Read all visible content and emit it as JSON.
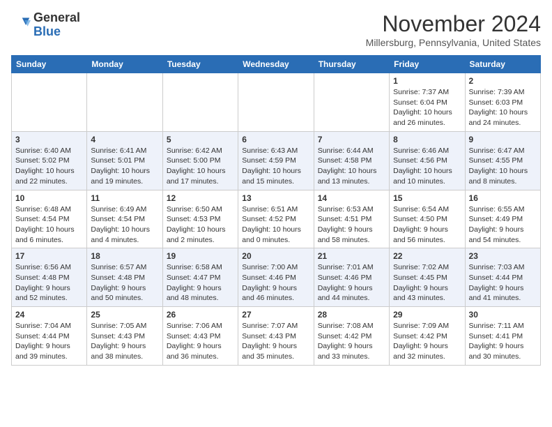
{
  "header": {
    "logo_general": "General",
    "logo_blue": "Blue",
    "month_title": "November 2024",
    "location": "Millersburg, Pennsylvania, United States"
  },
  "days_of_week": [
    "Sunday",
    "Monday",
    "Tuesday",
    "Wednesday",
    "Thursday",
    "Friday",
    "Saturday"
  ],
  "weeks": [
    {
      "days": [
        {
          "num": "",
          "info": ""
        },
        {
          "num": "",
          "info": ""
        },
        {
          "num": "",
          "info": ""
        },
        {
          "num": "",
          "info": ""
        },
        {
          "num": "",
          "info": ""
        },
        {
          "num": "1",
          "info": "Sunrise: 7:37 AM\nSunset: 6:04 PM\nDaylight: 10 hours and 26 minutes."
        },
        {
          "num": "2",
          "info": "Sunrise: 7:39 AM\nSunset: 6:03 PM\nDaylight: 10 hours and 24 minutes."
        }
      ]
    },
    {
      "days": [
        {
          "num": "3",
          "info": "Sunrise: 6:40 AM\nSunset: 5:02 PM\nDaylight: 10 hours and 22 minutes."
        },
        {
          "num": "4",
          "info": "Sunrise: 6:41 AM\nSunset: 5:01 PM\nDaylight: 10 hours and 19 minutes."
        },
        {
          "num": "5",
          "info": "Sunrise: 6:42 AM\nSunset: 5:00 PM\nDaylight: 10 hours and 17 minutes."
        },
        {
          "num": "6",
          "info": "Sunrise: 6:43 AM\nSunset: 4:59 PM\nDaylight: 10 hours and 15 minutes."
        },
        {
          "num": "7",
          "info": "Sunrise: 6:44 AM\nSunset: 4:58 PM\nDaylight: 10 hours and 13 minutes."
        },
        {
          "num": "8",
          "info": "Sunrise: 6:46 AM\nSunset: 4:56 PM\nDaylight: 10 hours and 10 minutes."
        },
        {
          "num": "9",
          "info": "Sunrise: 6:47 AM\nSunset: 4:55 PM\nDaylight: 10 hours and 8 minutes."
        }
      ]
    },
    {
      "days": [
        {
          "num": "10",
          "info": "Sunrise: 6:48 AM\nSunset: 4:54 PM\nDaylight: 10 hours and 6 minutes."
        },
        {
          "num": "11",
          "info": "Sunrise: 6:49 AM\nSunset: 4:54 PM\nDaylight: 10 hours and 4 minutes."
        },
        {
          "num": "12",
          "info": "Sunrise: 6:50 AM\nSunset: 4:53 PM\nDaylight: 10 hours and 2 minutes."
        },
        {
          "num": "13",
          "info": "Sunrise: 6:51 AM\nSunset: 4:52 PM\nDaylight: 10 hours and 0 minutes."
        },
        {
          "num": "14",
          "info": "Sunrise: 6:53 AM\nSunset: 4:51 PM\nDaylight: 9 hours and 58 minutes."
        },
        {
          "num": "15",
          "info": "Sunrise: 6:54 AM\nSunset: 4:50 PM\nDaylight: 9 hours and 56 minutes."
        },
        {
          "num": "16",
          "info": "Sunrise: 6:55 AM\nSunset: 4:49 PM\nDaylight: 9 hours and 54 minutes."
        }
      ]
    },
    {
      "days": [
        {
          "num": "17",
          "info": "Sunrise: 6:56 AM\nSunset: 4:48 PM\nDaylight: 9 hours and 52 minutes."
        },
        {
          "num": "18",
          "info": "Sunrise: 6:57 AM\nSunset: 4:48 PM\nDaylight: 9 hours and 50 minutes."
        },
        {
          "num": "19",
          "info": "Sunrise: 6:58 AM\nSunset: 4:47 PM\nDaylight: 9 hours and 48 minutes."
        },
        {
          "num": "20",
          "info": "Sunrise: 7:00 AM\nSunset: 4:46 PM\nDaylight: 9 hours and 46 minutes."
        },
        {
          "num": "21",
          "info": "Sunrise: 7:01 AM\nSunset: 4:46 PM\nDaylight: 9 hours and 44 minutes."
        },
        {
          "num": "22",
          "info": "Sunrise: 7:02 AM\nSunset: 4:45 PM\nDaylight: 9 hours and 43 minutes."
        },
        {
          "num": "23",
          "info": "Sunrise: 7:03 AM\nSunset: 4:44 PM\nDaylight: 9 hours and 41 minutes."
        }
      ]
    },
    {
      "days": [
        {
          "num": "24",
          "info": "Sunrise: 7:04 AM\nSunset: 4:44 PM\nDaylight: 9 hours and 39 minutes."
        },
        {
          "num": "25",
          "info": "Sunrise: 7:05 AM\nSunset: 4:43 PM\nDaylight: 9 hours and 38 minutes."
        },
        {
          "num": "26",
          "info": "Sunrise: 7:06 AM\nSunset: 4:43 PM\nDaylight: 9 hours and 36 minutes."
        },
        {
          "num": "27",
          "info": "Sunrise: 7:07 AM\nSunset: 4:43 PM\nDaylight: 9 hours and 35 minutes."
        },
        {
          "num": "28",
          "info": "Sunrise: 7:08 AM\nSunset: 4:42 PM\nDaylight: 9 hours and 33 minutes."
        },
        {
          "num": "29",
          "info": "Sunrise: 7:09 AM\nSunset: 4:42 PM\nDaylight: 9 hours and 32 minutes."
        },
        {
          "num": "30",
          "info": "Sunrise: 7:11 AM\nSunset: 4:41 PM\nDaylight: 9 hours and 30 minutes."
        }
      ]
    }
  ]
}
